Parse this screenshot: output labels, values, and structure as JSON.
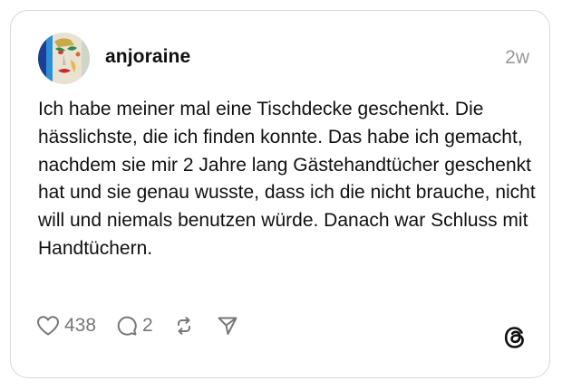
{
  "post": {
    "username": "anjoraine",
    "timestamp": "2w",
    "text": "Ich habe meiner mal eine Tischdecke geschenkt. Die hässlichste, die ich finden konnte. Das habe ich gemacht, nachdem sie mir 2 Jahre lang Gästehandtücher geschenkt hat und sie genau wusste, dass ich die nicht brauche, nicht will und niemals benutzen würde. Danach war Schluss mit Handtüchern."
  },
  "actions": {
    "likes": "438",
    "replies": "2",
    "like_icon": "heart-icon",
    "reply_icon": "speech-bubble-icon",
    "repost_icon": "repost-icon",
    "share_icon": "send-icon"
  },
  "branding": {
    "logo": "threads-logo-icon"
  },
  "colors": {
    "text": "#101010",
    "secondary": "#999999",
    "border": "#d9d9d9"
  }
}
